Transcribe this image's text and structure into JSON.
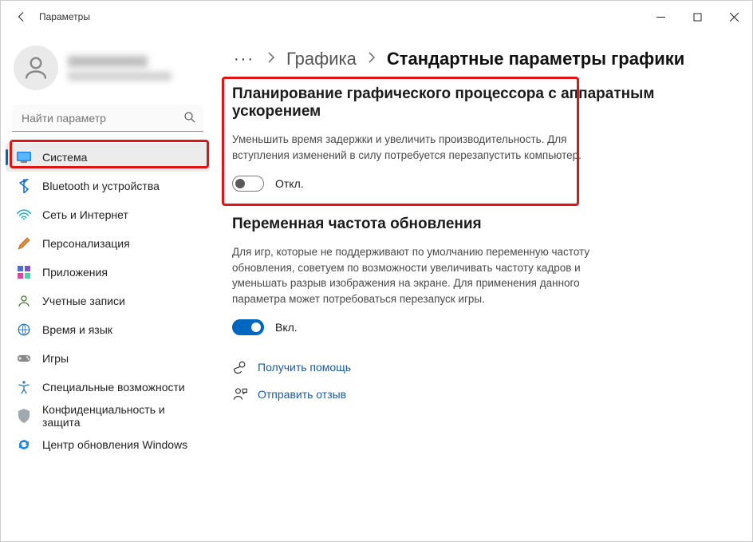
{
  "window": {
    "title": "Параметры"
  },
  "sidebar": {
    "search_placeholder": "Найти параметр",
    "items": [
      {
        "label": "Система",
        "icon": "system",
        "active": true
      },
      {
        "label": "Bluetooth и устройства",
        "icon": "bluetooth"
      },
      {
        "label": "Сеть и Интернет",
        "icon": "network"
      },
      {
        "label": "Персонализация",
        "icon": "personalize"
      },
      {
        "label": "Приложения",
        "icon": "apps"
      },
      {
        "label": "Учетные записи",
        "icon": "accounts"
      },
      {
        "label": "Время и язык",
        "icon": "time"
      },
      {
        "label": "Игры",
        "icon": "gaming"
      },
      {
        "label": "Специальные возможности",
        "icon": "accessibility"
      },
      {
        "label": "Конфиденциальность и защита",
        "icon": "privacy"
      },
      {
        "label": "Центр обновления Windows",
        "icon": "update"
      }
    ]
  },
  "breadcrumb": {
    "more": "···",
    "parent": "Графика",
    "current": "Стандартные параметры графики"
  },
  "section1": {
    "heading": "Планирование графического процессора с аппаратным ускорением",
    "desc": "Уменьшить время задержки и увеличить производительность. Для вступления изменений в силу потребуется перезапустить компьютер.",
    "toggle_state": "off",
    "toggle_label": "Откл."
  },
  "section2": {
    "heading": "Переменная частота обновления",
    "desc": "Для игр, которые не поддерживают по умолчанию переменную частоту обновления, советуем по возможности увеличивать частоту кадров и уменьшать разрыв изображения на экране. Для применения данного параметра может потребоваться перезапуск игры.",
    "toggle_state": "on",
    "toggle_label": "Вкл."
  },
  "footer": {
    "help": "Получить помощь",
    "feedback": "Отправить отзыв"
  }
}
